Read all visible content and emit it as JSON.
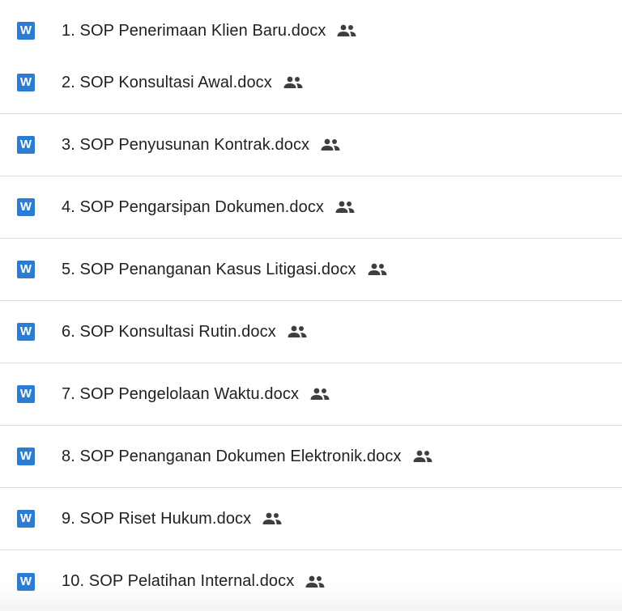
{
  "files": [
    {
      "name": "1. SOP Penerimaan Klien Baru.docx",
      "type_icon": "word-icon",
      "type_letter": "W",
      "shared_icon": "people-icon"
    },
    {
      "name": "2. SOP Konsultasi Awal.docx",
      "type_icon": "word-icon",
      "type_letter": "W",
      "shared_icon": "people-icon"
    },
    {
      "name": "3. SOP Penyusunan Kontrak.docx",
      "type_icon": "word-icon",
      "type_letter": "W",
      "shared_icon": "people-icon"
    },
    {
      "name": "4. SOP Pengarsipan Dokumen.docx",
      "type_icon": "word-icon",
      "type_letter": "W",
      "shared_icon": "people-icon"
    },
    {
      "name": "5. SOP Penanganan Kasus Litigasi.docx",
      "type_icon": "word-icon",
      "type_letter": "W",
      "shared_icon": "people-icon"
    },
    {
      "name": "6. SOP Konsultasi Rutin.docx",
      "type_icon": "word-icon",
      "type_letter": "W",
      "shared_icon": "people-icon"
    },
    {
      "name": "7. SOP Pengelolaan Waktu.docx",
      "type_icon": "word-icon",
      "type_letter": "W",
      "shared_icon": "people-icon"
    },
    {
      "name": "8. SOP Penanganan Dokumen Elektronik.docx",
      "type_icon": "word-icon",
      "type_letter": "W",
      "shared_icon": "people-icon"
    },
    {
      "name": "9. SOP Riset Hukum.docx",
      "type_icon": "word-icon",
      "type_letter": "W",
      "shared_icon": "people-icon"
    },
    {
      "name": "10. SOP Pelatihan Internal.docx",
      "type_icon": "word-icon",
      "type_letter": "W",
      "shared_icon": "people-icon"
    }
  ],
  "colors": {
    "word_blue": "#2b7cd3",
    "text": "#202124",
    "divider": "#dadce0",
    "icon_gray": "#3c4043"
  }
}
